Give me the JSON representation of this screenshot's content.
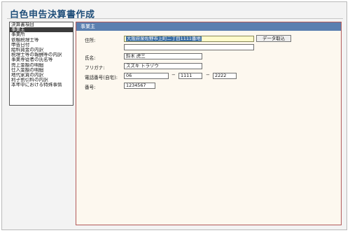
{
  "app": {
    "title": "白色申告決算書作成"
  },
  "sidebar": {
    "items": [
      {
        "label": "決算書項目",
        "selected": false
      },
      {
        "label": "事業主",
        "selected": true
      },
      {
        "label": "事業所",
        "selected": false
      },
      {
        "label": "依頼税理士等",
        "selected": false
      },
      {
        "label": "申告日付",
        "selected": false
      },
      {
        "label": "給料賃金の内訳",
        "selected": false
      },
      {
        "label": "税理士等の報酬等の内訳",
        "selected": false
      },
      {
        "label": "事業専従者の氏名等",
        "selected": false
      },
      {
        "label": "売上金額の明細",
        "selected": false
      },
      {
        "label": "仕入金額の明細",
        "selected": false
      },
      {
        "label": "地代家賃の内訳",
        "selected": false
      },
      {
        "label": "利子割引料の内訳",
        "selected": false
      },
      {
        "label": "本年中における特殊事情",
        "selected": false
      }
    ]
  },
  "panel": {
    "title": "事業主",
    "address": {
      "label": "住所:",
      "value": "大阪府泉佐野市上町二丁目1111番地",
      "value2": ""
    },
    "fetch_button": "データ取込",
    "name": {
      "label": "氏名:",
      "value": "鈴木 虎三"
    },
    "furigana": {
      "label": "フリガナ:",
      "value": "スズキ トラゾウ"
    },
    "phone": {
      "label": "電話番号(自宅):",
      "part1": "06",
      "part2": "1111",
      "part3": "2222",
      "separator": "−"
    },
    "number": {
      "label": "番号:",
      "value": "1234567"
    }
  }
}
